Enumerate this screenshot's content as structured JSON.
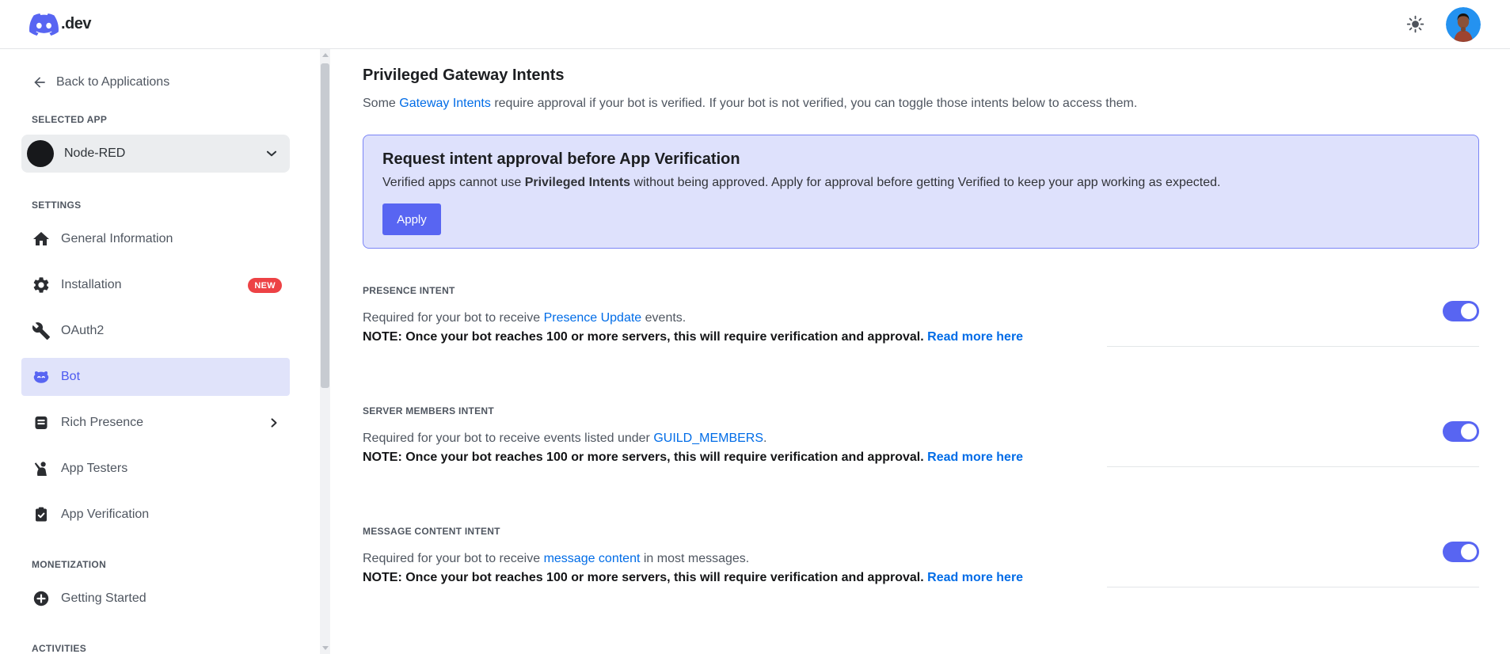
{
  "header": {
    "logo_suffix": ".dev"
  },
  "sidebar": {
    "back_label": "Back to Applications",
    "selected_app_label": "SELECTED APP",
    "app_name": "Node-RED",
    "settings_label": "SETTINGS",
    "nav": [
      {
        "label": "General Information",
        "icon": "home-icon"
      },
      {
        "label": "Installation",
        "icon": "gear-icon",
        "badge": "NEW"
      },
      {
        "label": "OAuth2",
        "icon": "wrench-icon"
      },
      {
        "label": "Bot",
        "icon": "bot-icon",
        "selected": true
      },
      {
        "label": "Rich Presence",
        "icon": "document-icon",
        "has_submenu": true
      },
      {
        "label": "App Testers",
        "icon": "person-raised-hand-icon"
      },
      {
        "label": "App Verification",
        "icon": "clipboard-check-icon"
      }
    ],
    "monetization_label": "MONETIZATION",
    "monetization_nav": [
      {
        "label": "Getting Started",
        "icon": "plus-circle-icon"
      }
    ],
    "activities_label": "ACTIVITIES"
  },
  "main": {
    "title": "Privileged Gateway Intents",
    "intro": {
      "before": "Some ",
      "link": "Gateway Intents",
      "after": " require approval if your bot is verified. If your bot is not verified, you can toggle those intents below to access them."
    },
    "banner": {
      "title": "Request intent approval before App Verification",
      "body_before": "Verified apps cannot use ",
      "body_bold": "Privileged Intents",
      "body_after": " without being approved. Apply for approval before getting Verified to keep your app working as expected.",
      "apply_label": "Apply"
    },
    "intents": [
      {
        "label": "PRESENCE INTENT",
        "desc_before": "Required for your bot to receive ",
        "desc_link": "Presence Update",
        "desc_after": " events.",
        "note": "NOTE: Once your bot reaches 100 or more servers, this will require verification and approval.",
        "note_link": "Read more here",
        "enabled": true
      },
      {
        "label": "SERVER MEMBERS INTENT",
        "desc_before": "Required for your bot to receive events listed under ",
        "desc_link": "GUILD_MEMBERS",
        "desc_after": ".",
        "note": "NOTE: Once your bot reaches 100 or more servers, this will require verification and approval.",
        "note_link": "Read more here",
        "enabled": true
      },
      {
        "label": "MESSAGE CONTENT INTENT",
        "desc_before": "Required for your bot to receive ",
        "desc_link": "message content",
        "desc_after": " in most messages.",
        "note": "NOTE: Once your bot reaches 100 or more servers, this will require verification and approval.",
        "note_link": "Read more here",
        "enabled": true
      }
    ]
  },
  "colors": {
    "blurple": "#5865f2",
    "link_blue": "#006ce7",
    "badge_red": "#ed4245",
    "banner_bg": "#dee1fc",
    "banner_border": "#7a84f6",
    "toggle_on": "#5865f2",
    "selected_nav_bg": "#e0e3fa"
  }
}
